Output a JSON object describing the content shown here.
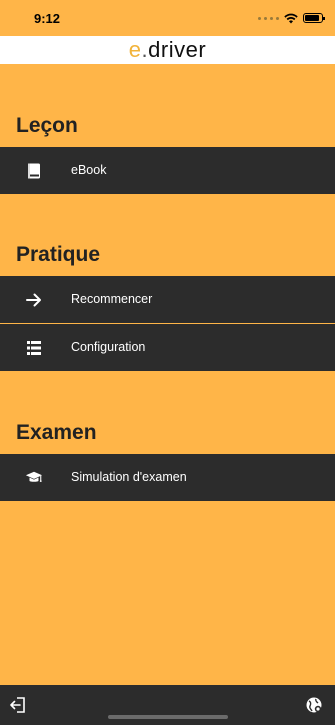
{
  "status_bar": {
    "time": "9:12"
  },
  "header": {
    "logo_e": "e",
    "logo_dot": ".",
    "logo_rest": "driver"
  },
  "sections": {
    "lecon": {
      "title": "Leçon",
      "items": [
        {
          "label": "eBook",
          "icon": "book-icon"
        }
      ]
    },
    "pratique": {
      "title": "Pratique",
      "items": [
        {
          "label": "Recommencer",
          "icon": "arrow-right-icon"
        },
        {
          "label": "Configuration",
          "icon": "list-icon"
        }
      ]
    },
    "examen": {
      "title": "Examen",
      "items": [
        {
          "label": "Simulation d'examen",
          "icon": "graduation-cap-icon"
        }
      ]
    }
  },
  "bottom_bar": {
    "left_icon": "logout-icon",
    "right_icon": "globe-settings-icon"
  },
  "colors": {
    "background": "#FFB548",
    "row": "#2C2C2C",
    "logo_accent": "#F2B33A"
  }
}
